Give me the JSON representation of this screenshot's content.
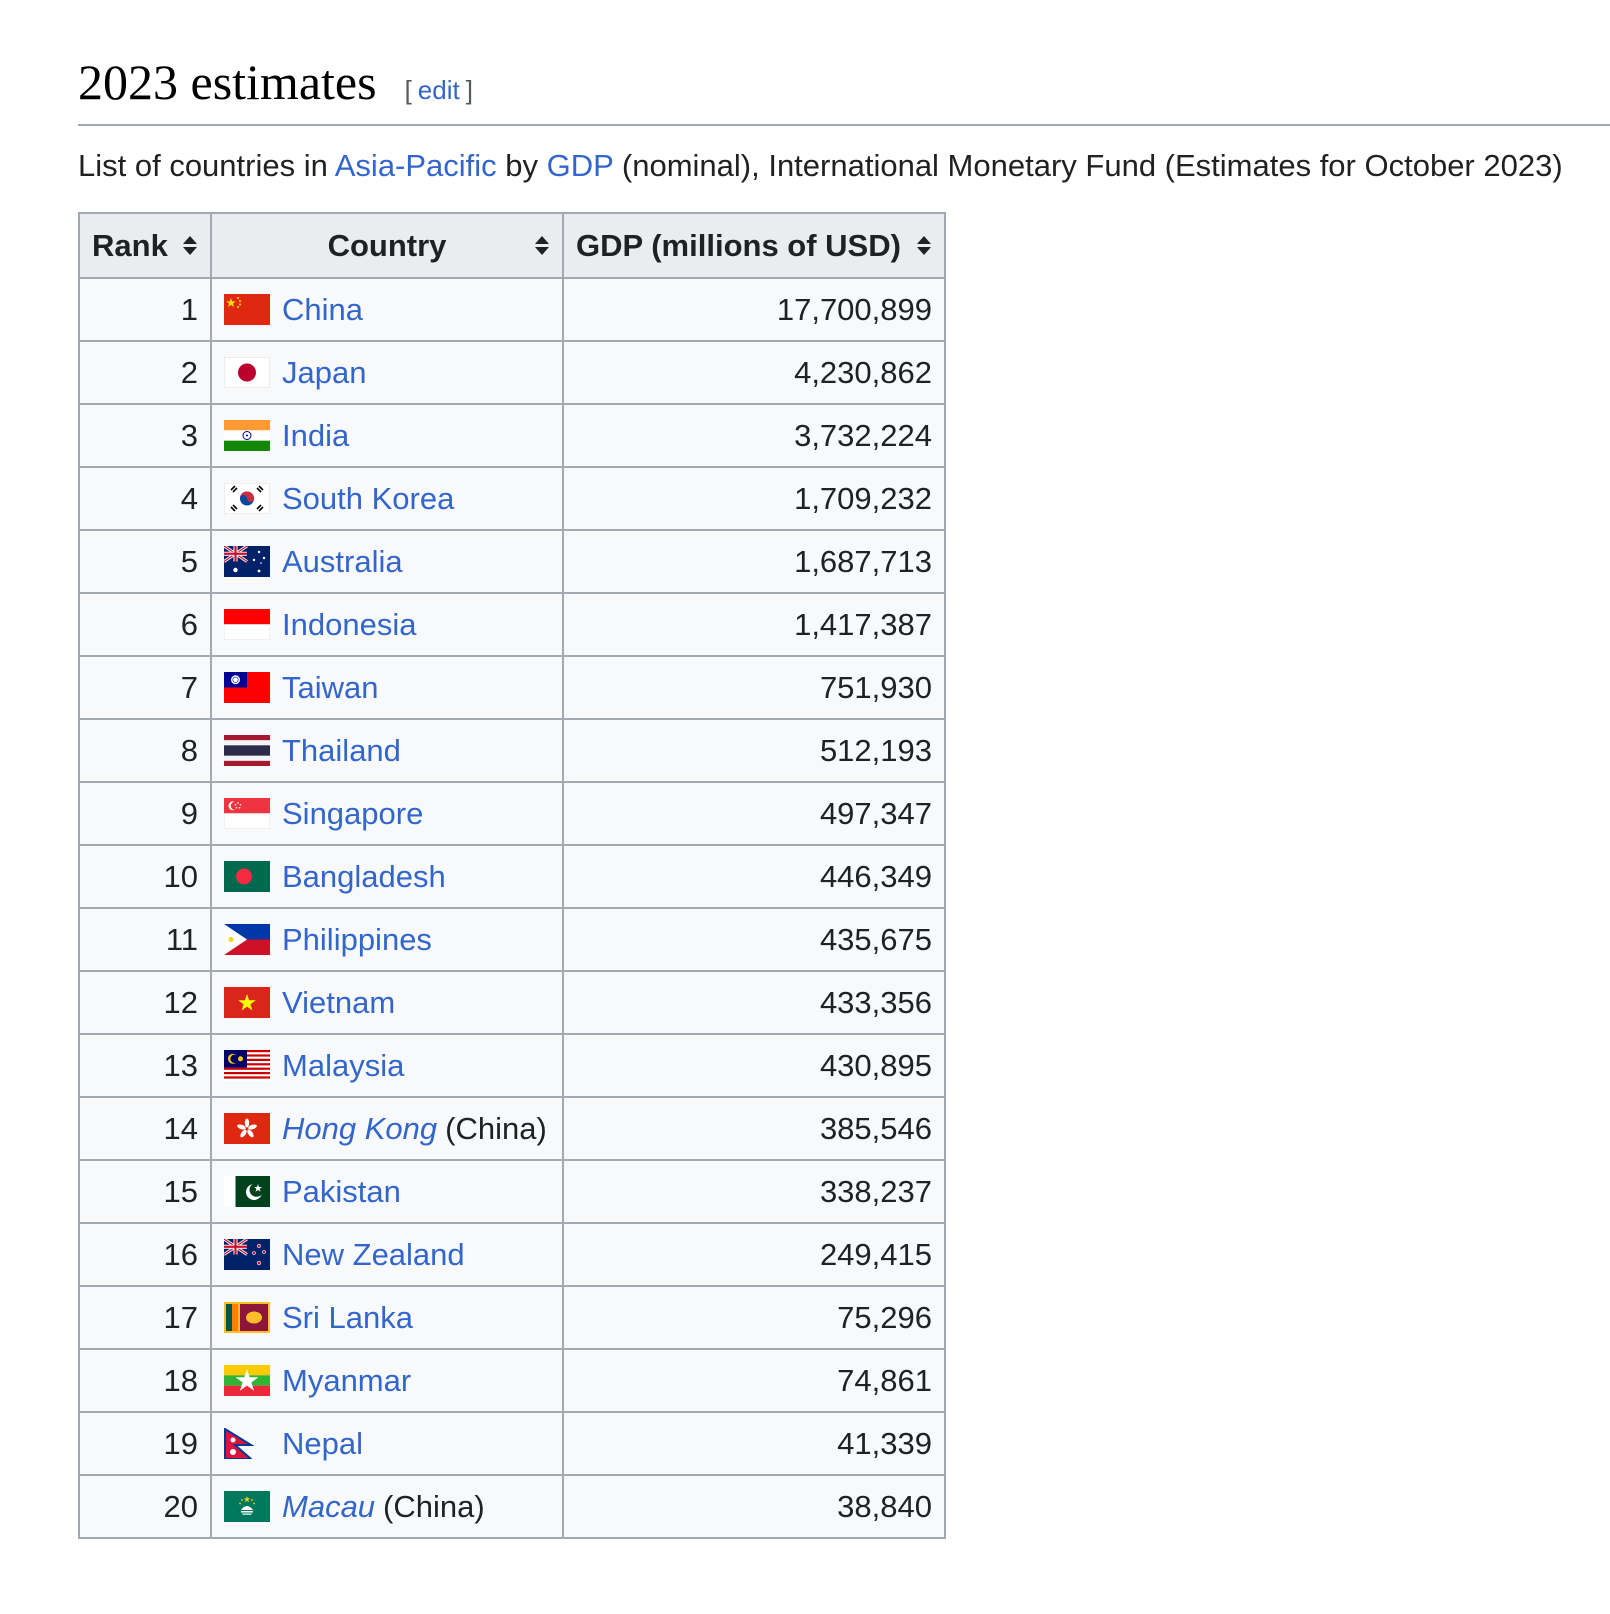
{
  "section": {
    "title": "2023 estimates",
    "edit_open": "[",
    "edit_label": "edit",
    "edit_close": "]"
  },
  "caption": {
    "prefix": "List of countries in ",
    "link1": "Asia-Pacific",
    "middle": " by ",
    "link2": "GDP",
    "suffix": " (nominal), International Monetary Fund (Estimates for October 2023)"
  },
  "table": {
    "headers": {
      "rank": "Rank",
      "country": "Country",
      "gdp": "GDP (millions of USD)"
    },
    "rows": [
      {
        "rank": "1",
        "country": "China",
        "gdp": "17,700,899",
        "flag": "china-flag-icon"
      },
      {
        "rank": "2",
        "country": "Japan",
        "gdp": "4,230,862",
        "flag": "japan-flag-icon"
      },
      {
        "rank": "3",
        "country": "India",
        "gdp": "3,732,224",
        "flag": "india-flag-icon"
      },
      {
        "rank": "4",
        "country": "South Korea",
        "gdp": "1,709,232",
        "flag": "south-korea-flag-icon"
      },
      {
        "rank": "5",
        "country": "Australia",
        "gdp": "1,687,713",
        "flag": "australia-flag-icon"
      },
      {
        "rank": "6",
        "country": "Indonesia",
        "gdp": "1,417,387",
        "flag": "indonesia-flag-icon"
      },
      {
        "rank": "7",
        "country": "Taiwan",
        "gdp": "751,930",
        "flag": "taiwan-flag-icon"
      },
      {
        "rank": "8",
        "country": "Thailand",
        "gdp": "512,193",
        "flag": "thailand-flag-icon"
      },
      {
        "rank": "9",
        "country": "Singapore",
        "gdp": "497,347",
        "flag": "singapore-flag-icon"
      },
      {
        "rank": "10",
        "country": "Bangladesh",
        "gdp": "446,349",
        "flag": "bangladesh-flag-icon"
      },
      {
        "rank": "11",
        "country": "Philippines",
        "gdp": "435,675",
        "flag": "philippines-flag-icon"
      },
      {
        "rank": "12",
        "country": "Vietnam",
        "gdp": "433,356",
        "flag": "vietnam-flag-icon"
      },
      {
        "rank": "13",
        "country": "Malaysia",
        "gdp": "430,895",
        "flag": "malaysia-flag-icon"
      },
      {
        "rank": "14",
        "country": "Hong Kong",
        "country_suffix": "(China)",
        "italic": true,
        "gdp": "385,546",
        "flag": "hong-kong-flag-icon"
      },
      {
        "rank": "15",
        "country": "Pakistan",
        "gdp": "338,237",
        "flag": "pakistan-flag-icon"
      },
      {
        "rank": "16",
        "country": "New Zealand",
        "gdp": "249,415",
        "flag": "new-zealand-flag-icon"
      },
      {
        "rank": "17",
        "country": "Sri Lanka",
        "gdp": "75,296",
        "flag": "sri-lanka-flag-icon"
      },
      {
        "rank": "18",
        "country": "Myanmar",
        "gdp": "74,861",
        "flag": "myanmar-flag-icon"
      },
      {
        "rank": "19",
        "country": "Nepal",
        "gdp": "41,339",
        "flag": "nepal-flag-icon"
      },
      {
        "rank": "20",
        "country": "Macau",
        "country_suffix": "(China)",
        "italic": true,
        "gdp": "38,840",
        "flag": "macau-flag-icon"
      }
    ]
  },
  "colors": {
    "link": "#3366cc",
    "border": "#a2a9b1",
    "header_bg": "#eaecf0",
    "cell_bg": "#f8f9fa"
  }
}
